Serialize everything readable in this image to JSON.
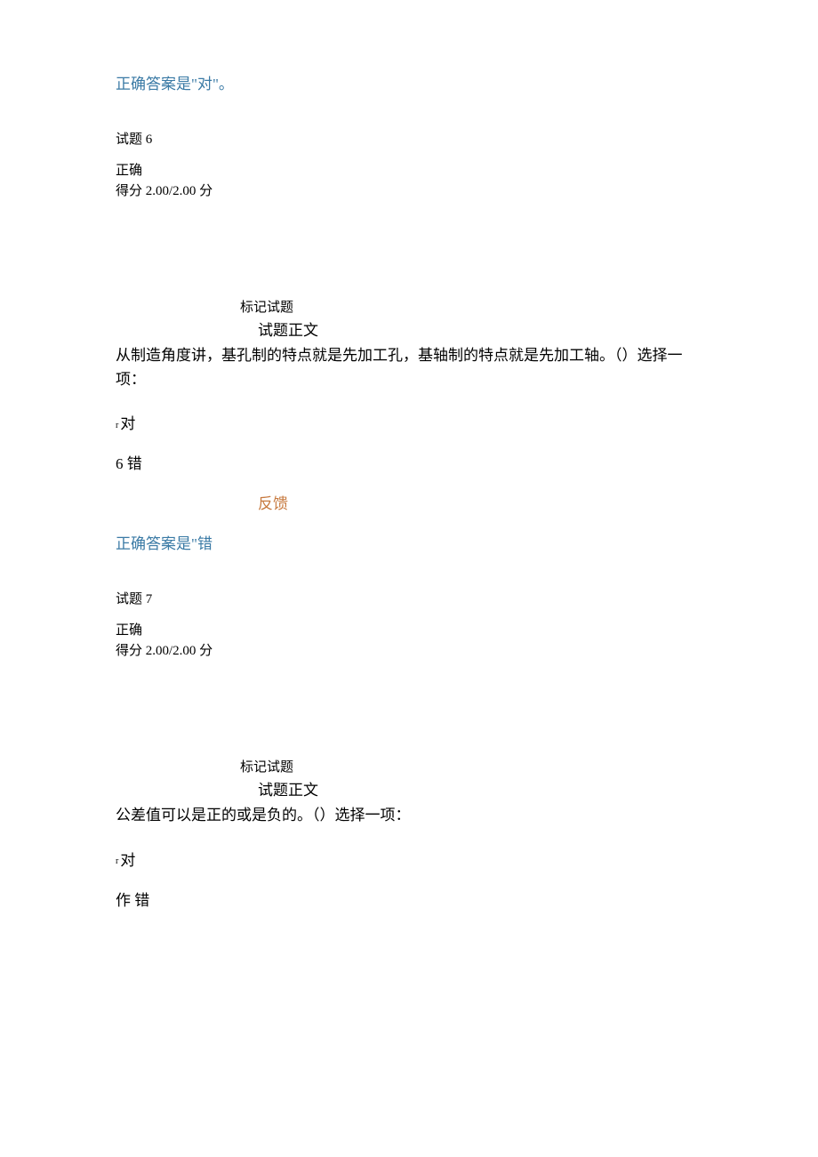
{
  "answer5": "正确答案是\"对\"。",
  "q6": {
    "number": "试题 6",
    "status": "正确",
    "score": "得分 2.00/2.00 分",
    "mark": "标记试题",
    "sectionTitle": "试题正文",
    "text": "从制造角度讲，基孔制的特点就是先加工孔，基轴制的特点就是先加工轴。（）选择一项：",
    "optA": "对",
    "optAPrefix": "r",
    "optB": "6 错",
    "feedbackTitle": "反馈",
    "answer": "正确答案是\"错"
  },
  "q7": {
    "number": "试题 7",
    "status": "正确",
    "score": "得分 2.00/2.00 分",
    "mark": "标记试题",
    "sectionTitle": "试题正文",
    "text": "公差值可以是正的或是负的。（）选择一项：",
    "optA": "对",
    "optAPrefix": "r",
    "optB": "作 错"
  }
}
